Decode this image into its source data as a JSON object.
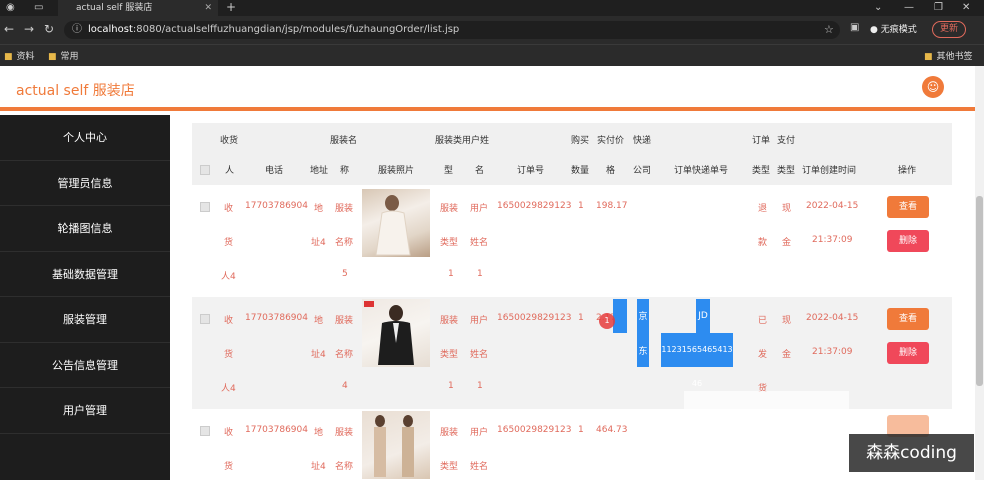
{
  "browser": {
    "tab_title": "actual self 服装店",
    "url_host": "localhost",
    "url_path": ":8080/actualselffuzhuangdian/jsp/modules/fuzhaungOrder/list.jsp",
    "profile_label": "无痕模式",
    "update_label": "更新",
    "bookmarks": [
      "资料",
      "常用"
    ],
    "bookmarks_right": "其他书签"
  },
  "app": {
    "title": "actual self 服装店"
  },
  "sidebar": {
    "items": [
      {
        "label": "个人中心"
      },
      {
        "label": "管理员信息"
      },
      {
        "label": "轮播图信息"
      },
      {
        "label": "基础数据管理"
      },
      {
        "label": "服装管理"
      },
      {
        "label": "公告信息管理"
      },
      {
        "label": "用户管理"
      }
    ]
  },
  "table": {
    "headers_top": {
      "receiver": "收货",
      "clothes_name": "服装名",
      "type_user": "服装类用户姓",
      "buy_price": "购买",
      "real_price": "实付价",
      "express": "快递",
      "order_pay": "订单",
      "pay": "支付"
    },
    "headers": {
      "person": "人",
      "phone": "电话",
      "address": "地址",
      "name": "称",
      "photo": "服装照片",
      "type": "型",
      "uname": "名",
      "order_no": "订单号",
      "qty": "数量",
      "price": "格",
      "company": "公司",
      "tracking": "订单快递单号",
      "order_type": "类型",
      "pay_type": "类型",
      "created": "订单创建时间",
      "action": "操作"
    },
    "rows": [
      {
        "receiver": [
          "收",
          "货",
          "人4"
        ],
        "phone": "17703786904",
        "address": [
          "地",
          "址4"
        ],
        "name": [
          "服装",
          "名称",
          "5"
        ],
        "type": [
          "服装",
          "类型",
          "1"
        ],
        "uname": [
          "用户",
          "姓名",
          "1"
        ],
        "order_no": "1650029829123",
        "qty": "1",
        "price": "198.17",
        "company": "",
        "tracking": "",
        "order_type": [
          "退",
          "款"
        ],
        "pay_type": [
          "现",
          "金"
        ],
        "created_date": "2022-04-15",
        "created_time": "21:37:09",
        "view": "查看",
        "delete": "删除"
      },
      {
        "receiver": [
          "收",
          "货",
          "人4"
        ],
        "phone": "17703786904",
        "address": [
          "地",
          "址4"
        ],
        "name": [
          "服装",
          "名称",
          "4"
        ],
        "type": [
          "服装",
          "类型",
          "1"
        ],
        "uname": [
          "用户",
          "姓名",
          "1"
        ],
        "order_no": "1650029829123",
        "qty": "1",
        "price": "2.17",
        "company": [
          "京",
          "东"
        ],
        "tracking": [
          "JD",
          "11231565465413 46"
        ],
        "order_type": [
          "已",
          "发",
          "货"
        ],
        "pay_type": [
          "现",
          "金"
        ],
        "created_date": "2022-04-15",
        "created_time": "21:37:09",
        "view": "查看",
        "delete": "删除"
      },
      {
        "receiver": [
          "收",
          "货"
        ],
        "phone": "17703786904",
        "address": [
          "地",
          "址4"
        ],
        "name": [
          "服装",
          "名称"
        ],
        "type": [
          "服装",
          "类型"
        ],
        "uname": [
          "用户",
          "姓名"
        ],
        "order_no": "1650029829123",
        "qty": "1",
        "price": "464.73"
      }
    ]
  },
  "cursor_label": "1",
  "watermark": "森森coding",
  "colors": {
    "accent": "#f07a3a",
    "danger": "#f0485a",
    "sidebar_bg": "#1d1d1d",
    "cell_text": "#e06a5c",
    "selection": "#2d8cf0"
  }
}
